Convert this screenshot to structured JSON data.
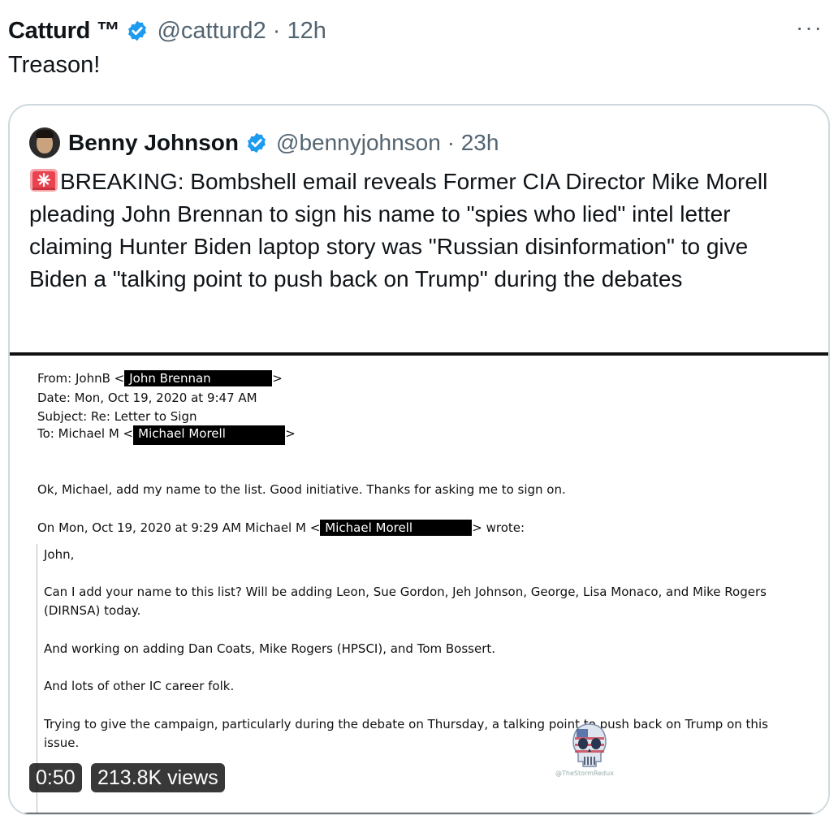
{
  "tweet": {
    "author_name": "Catturd ™",
    "handle_time": "@catturd2 · 12h",
    "more_label": "···",
    "text": "Treason!"
  },
  "quoted": {
    "author_name": "Benny Johnson",
    "handle_time": "@bennyjohnson · 23h",
    "text": "BREAKING: Bombshell email reveals Former CIA Director Mike Morell pleading John Brennan to sign his name to \"spies who lied\" intel letter claiming Hunter Biden laptop story was \"Russian disinformation\" to give Biden a \"talking point to push back on Trump\" during the debates"
  },
  "email": {
    "from_prefix": "From: JohnB <",
    "from_redacted": "John Brennan",
    "from_suffix": ">",
    "date": "Date: Mon, Oct 19, 2020 at 9:47 AM",
    "subject": "Subject: Re: Letter to Sign",
    "to_prefix": "To: Michael M <",
    "to_redacted": "Michael Morell",
    "to_suffix": ">",
    "reply": "Ok, Michael, add my name to the list.  Good initiative.  Thanks for asking me to sign on.",
    "on_prefix": "On Mon, Oct 19, 2020 at 9:29 AM Michael M <",
    "on_redacted": "Michael Morell",
    "on_suffix": "> wrote:",
    "greeting": "John,",
    "p1_l1": "Can I add your name to this list?  Will be adding Leon, Sue Gordon, Jeh Johnson, George, Lisa Monaco, and Mike Rogers",
    "p1_l2": "(DIRNSA) today.",
    "p2": "And working on adding Dan Coats, Mike Rogers (HPSCI), and Tom Bossert.",
    "p3": "And lots of other IC career folk.",
    "p4_l1": "Trying to give the campaign, particularly during the debate on Thursday, a talking point to push back on Trump on this",
    "p4_l2": "issue.",
    "watermark_text": "@TheStormRedux"
  },
  "video": {
    "duration": "0:50",
    "views": "213.8K views"
  },
  "colors": {
    "verified_blue": "#1d9bf0",
    "secondary_text": "#536471",
    "border": "#cfd9de"
  },
  "icons": [
    "verified-badge-icon",
    "more-icon",
    "siren-icon"
  ]
}
